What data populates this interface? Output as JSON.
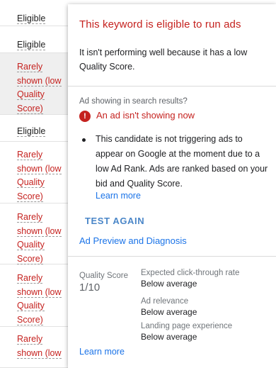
{
  "table": {
    "rows": [
      {
        "status": "eligible",
        "lines": [
          "Eligible"
        ]
      },
      {
        "status": "eligible",
        "lines": [
          "Eligible"
        ]
      },
      {
        "status": "rarely",
        "lines": [
          "Rarely",
          "shown (low",
          "Quality",
          "Score)"
        ]
      },
      {
        "status": "eligible",
        "lines": [
          "Eligible"
        ]
      },
      {
        "status": "rarely",
        "lines": [
          "Rarely",
          "shown (low",
          "Quality",
          "Score)"
        ]
      },
      {
        "status": "rarely",
        "lines": [
          "Rarely",
          "shown (low",
          "Quality",
          "Score)"
        ]
      },
      {
        "status": "rarely",
        "lines": [
          "Rarely",
          "shown (low",
          "Quality",
          "Score)"
        ]
      },
      {
        "status": "rarely",
        "lines": [
          "Rarely",
          "shown (low"
        ]
      }
    ]
  },
  "popup": {
    "title": "This keyword is eligible to run ads",
    "description": "It isn't performing well because it has a low Quality Score.",
    "ad_showing_question": "Ad showing in search results?",
    "status_icon": "alert-icon",
    "status_text": "An ad isn't showing now",
    "bullet_text": "This candidate is not triggering ads to appear on Google at the moment due to a low Ad Rank. Ads are ranked based on your bid and Quality Score.",
    "learn_more_1": "Learn more",
    "test_again": "TEST AGAIN",
    "ad_preview": "Ad Preview and Diagnosis",
    "quality_score_label": "Quality Score",
    "quality_score_value": "1/10",
    "metrics": [
      {
        "label": "Expected click-through rate",
        "value": "Below average"
      },
      {
        "label": "Ad relevance",
        "value": "Below average"
      },
      {
        "label": "Landing page experience",
        "value": "Below average"
      }
    ],
    "learn_more_2": "Learn more"
  },
  "colors": {
    "error_red": "#c5221f",
    "link_blue": "#1a73e8",
    "button_blue": "#4a86c8"
  }
}
